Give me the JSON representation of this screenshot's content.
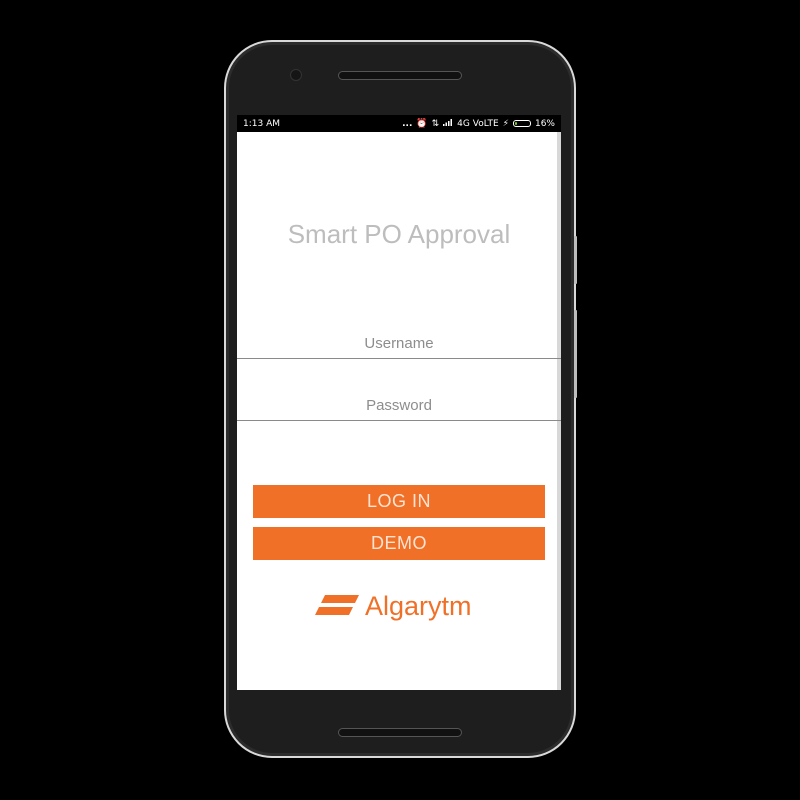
{
  "status_bar": {
    "time": "1:13 AM",
    "dots": "...",
    "network": "4G VoLTE",
    "battery_percent": "16%",
    "battery_level": 0.16,
    "icons": [
      "alarm-icon",
      "data-arrows-icon",
      "signal-icon",
      "charging-bolt-icon",
      "battery-icon"
    ]
  },
  "app": {
    "title": "Smart PO Approval",
    "username_placeholder": "Username",
    "password_placeholder": "Password",
    "login_label": "LOG IN",
    "demo_label": "DEMO",
    "logo_text": "Algarytm"
  },
  "colors": {
    "accent": "#f07028",
    "title_gray": "#bdbdbd",
    "background": "#ffffff"
  }
}
